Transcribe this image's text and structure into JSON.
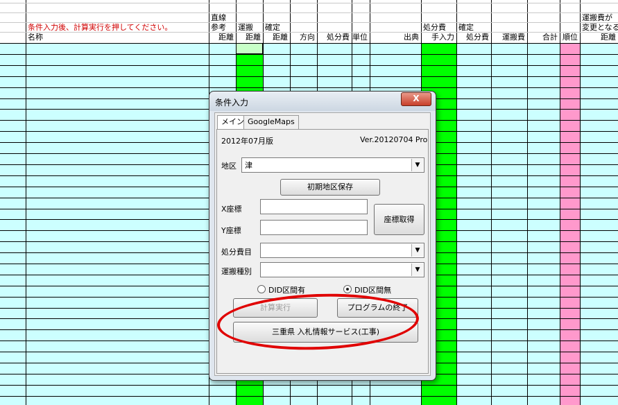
{
  "sheet": {
    "instruction": "条件入力後、計算実行を押してください。",
    "col_name": "名称",
    "headers": [
      {
        "id": "straight",
        "lines": [
          "直線",
          "参考",
          "距離"
        ]
      },
      {
        "id": "haul",
        "lines": [
          "",
          "運搬",
          "距離"
        ]
      },
      {
        "id": "confirm_dist",
        "lines": [
          "",
          "確定",
          "距離"
        ]
      },
      {
        "id": "direction",
        "lines": [
          "",
          "",
          "方向"
        ]
      },
      {
        "id": "disposal_cost",
        "lines": [
          "",
          "",
          "処分費"
        ]
      },
      {
        "id": "unit",
        "lines": [
          "",
          "",
          "単位"
        ]
      },
      {
        "id": "source",
        "lines": [
          "",
          "",
          "出典"
        ]
      },
      {
        "id": "manual",
        "lines": [
          "",
          "処分費",
          "手入力"
        ]
      },
      {
        "id": "confirm_disposal",
        "lines": [
          "",
          "確定",
          "処分費"
        ]
      },
      {
        "id": "haul_cost",
        "lines": [
          "",
          "",
          "運搬費"
        ]
      },
      {
        "id": "total",
        "lines": [
          "",
          "",
          "合計"
        ]
      },
      {
        "id": "rank",
        "lines": [
          "",
          "",
          "順位"
        ]
      },
      {
        "id": "change_dist",
        "lines": [
          "運搬費が",
          "変更となる",
          "距離"
        ]
      }
    ],
    "colors": {
      "row_fill": "#ccffff",
      "green": "#00ff00",
      "pink": "#ff99cc",
      "instruction": "#d00000"
    }
  },
  "dialog": {
    "title": "条件入力",
    "close_label": "X",
    "tabs": [
      "メイン",
      "GoogleMaps"
    ],
    "edition": "2012年07月版",
    "version": "Ver.20120704 Pro",
    "district_label": "地区",
    "district_value": "津",
    "save_district_button": "初期地区保存",
    "x_label": "X座標",
    "y_label": "Y座標",
    "x_value": "",
    "y_value": "",
    "get_coords_button": "座標取得",
    "disposal_item_label": "処分費目",
    "disposal_item_value": "",
    "transport_type_label": "運搬種別",
    "transport_type_value": "",
    "radio_did_yes": "DID区間有",
    "radio_did_no": "DID区間無",
    "selected_radio": "DID区間無",
    "calc_button": "計算実行",
    "exit_button": "プログラムの終了",
    "bid_info_button": "三重県 入札情報サービス(工事)",
    "highlight_color": "#e00000"
  }
}
